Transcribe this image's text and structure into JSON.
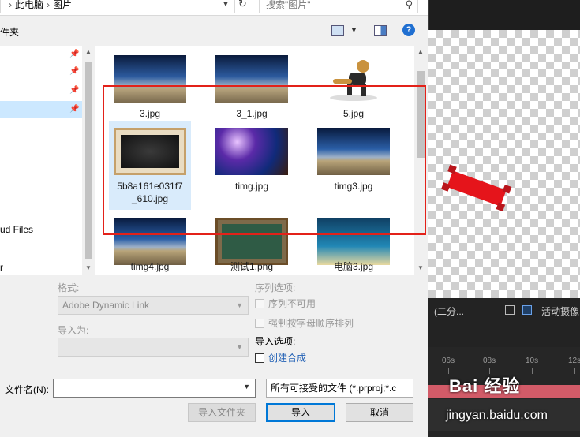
{
  "dialog": {
    "breadcrumb": [
      "此电脑",
      "图片"
    ],
    "search_placeholder": "搜索\"图片\"",
    "toolbar_label": "件夹",
    "help_label": "?",
    "nav_items": [
      {
        "label": ""
      },
      {
        "label": ""
      },
      {
        "label": ""
      },
      {
        "label": ""
      },
      {
        "label": "ud Files"
      },
      {
        "label": "r"
      }
    ],
    "files": [
      {
        "name": "3.jpg"
      },
      {
        "name": "3_1.jpg"
      },
      {
        "name": "5.jpg"
      },
      {
        "name": "5b8a161e031f7_610.jpg",
        "name_line1": "5b8a161e031f7",
        "name_line2": "_610.jpg",
        "selected": true
      },
      {
        "name": "timg.jpg"
      },
      {
        "name": "timg3.jpg"
      },
      {
        "name": "timg4.jpg"
      },
      {
        "name": "测试1.png"
      },
      {
        "name": "电脑3.jpg"
      }
    ],
    "format_label": "格式:",
    "format_value": "Adobe Dynamic Link",
    "import_as_label": "导入为:",
    "sequence_options_label": "序列选项:",
    "sequence_unavailable": "序列不可用",
    "force_alpha_order": "强制按字母顺序排列",
    "import_options_label": "导入选项:",
    "create_composition": "创建合成",
    "filename_label": "文件名",
    "filename_mnemonic": "(N):",
    "filename_value": "",
    "filter_value": "所有可接受的文件 (*.prproj;*.c",
    "import_folder_button": "导入文件夹",
    "import_button": "导入",
    "cancel_button": "取消"
  },
  "app": {
    "zoom_text": "(二分...",
    "camera_text": "活动摄像",
    "ruler": [
      "06s",
      "08s",
      "10s",
      "12s"
    ]
  },
  "watermark": {
    "brand": "Bai 经验",
    "url": "jingyan.baidu.com"
  },
  "colors": {
    "highlight_box": "#e32119",
    "selection": "#d9ebfb",
    "accent": "#0078d7"
  }
}
